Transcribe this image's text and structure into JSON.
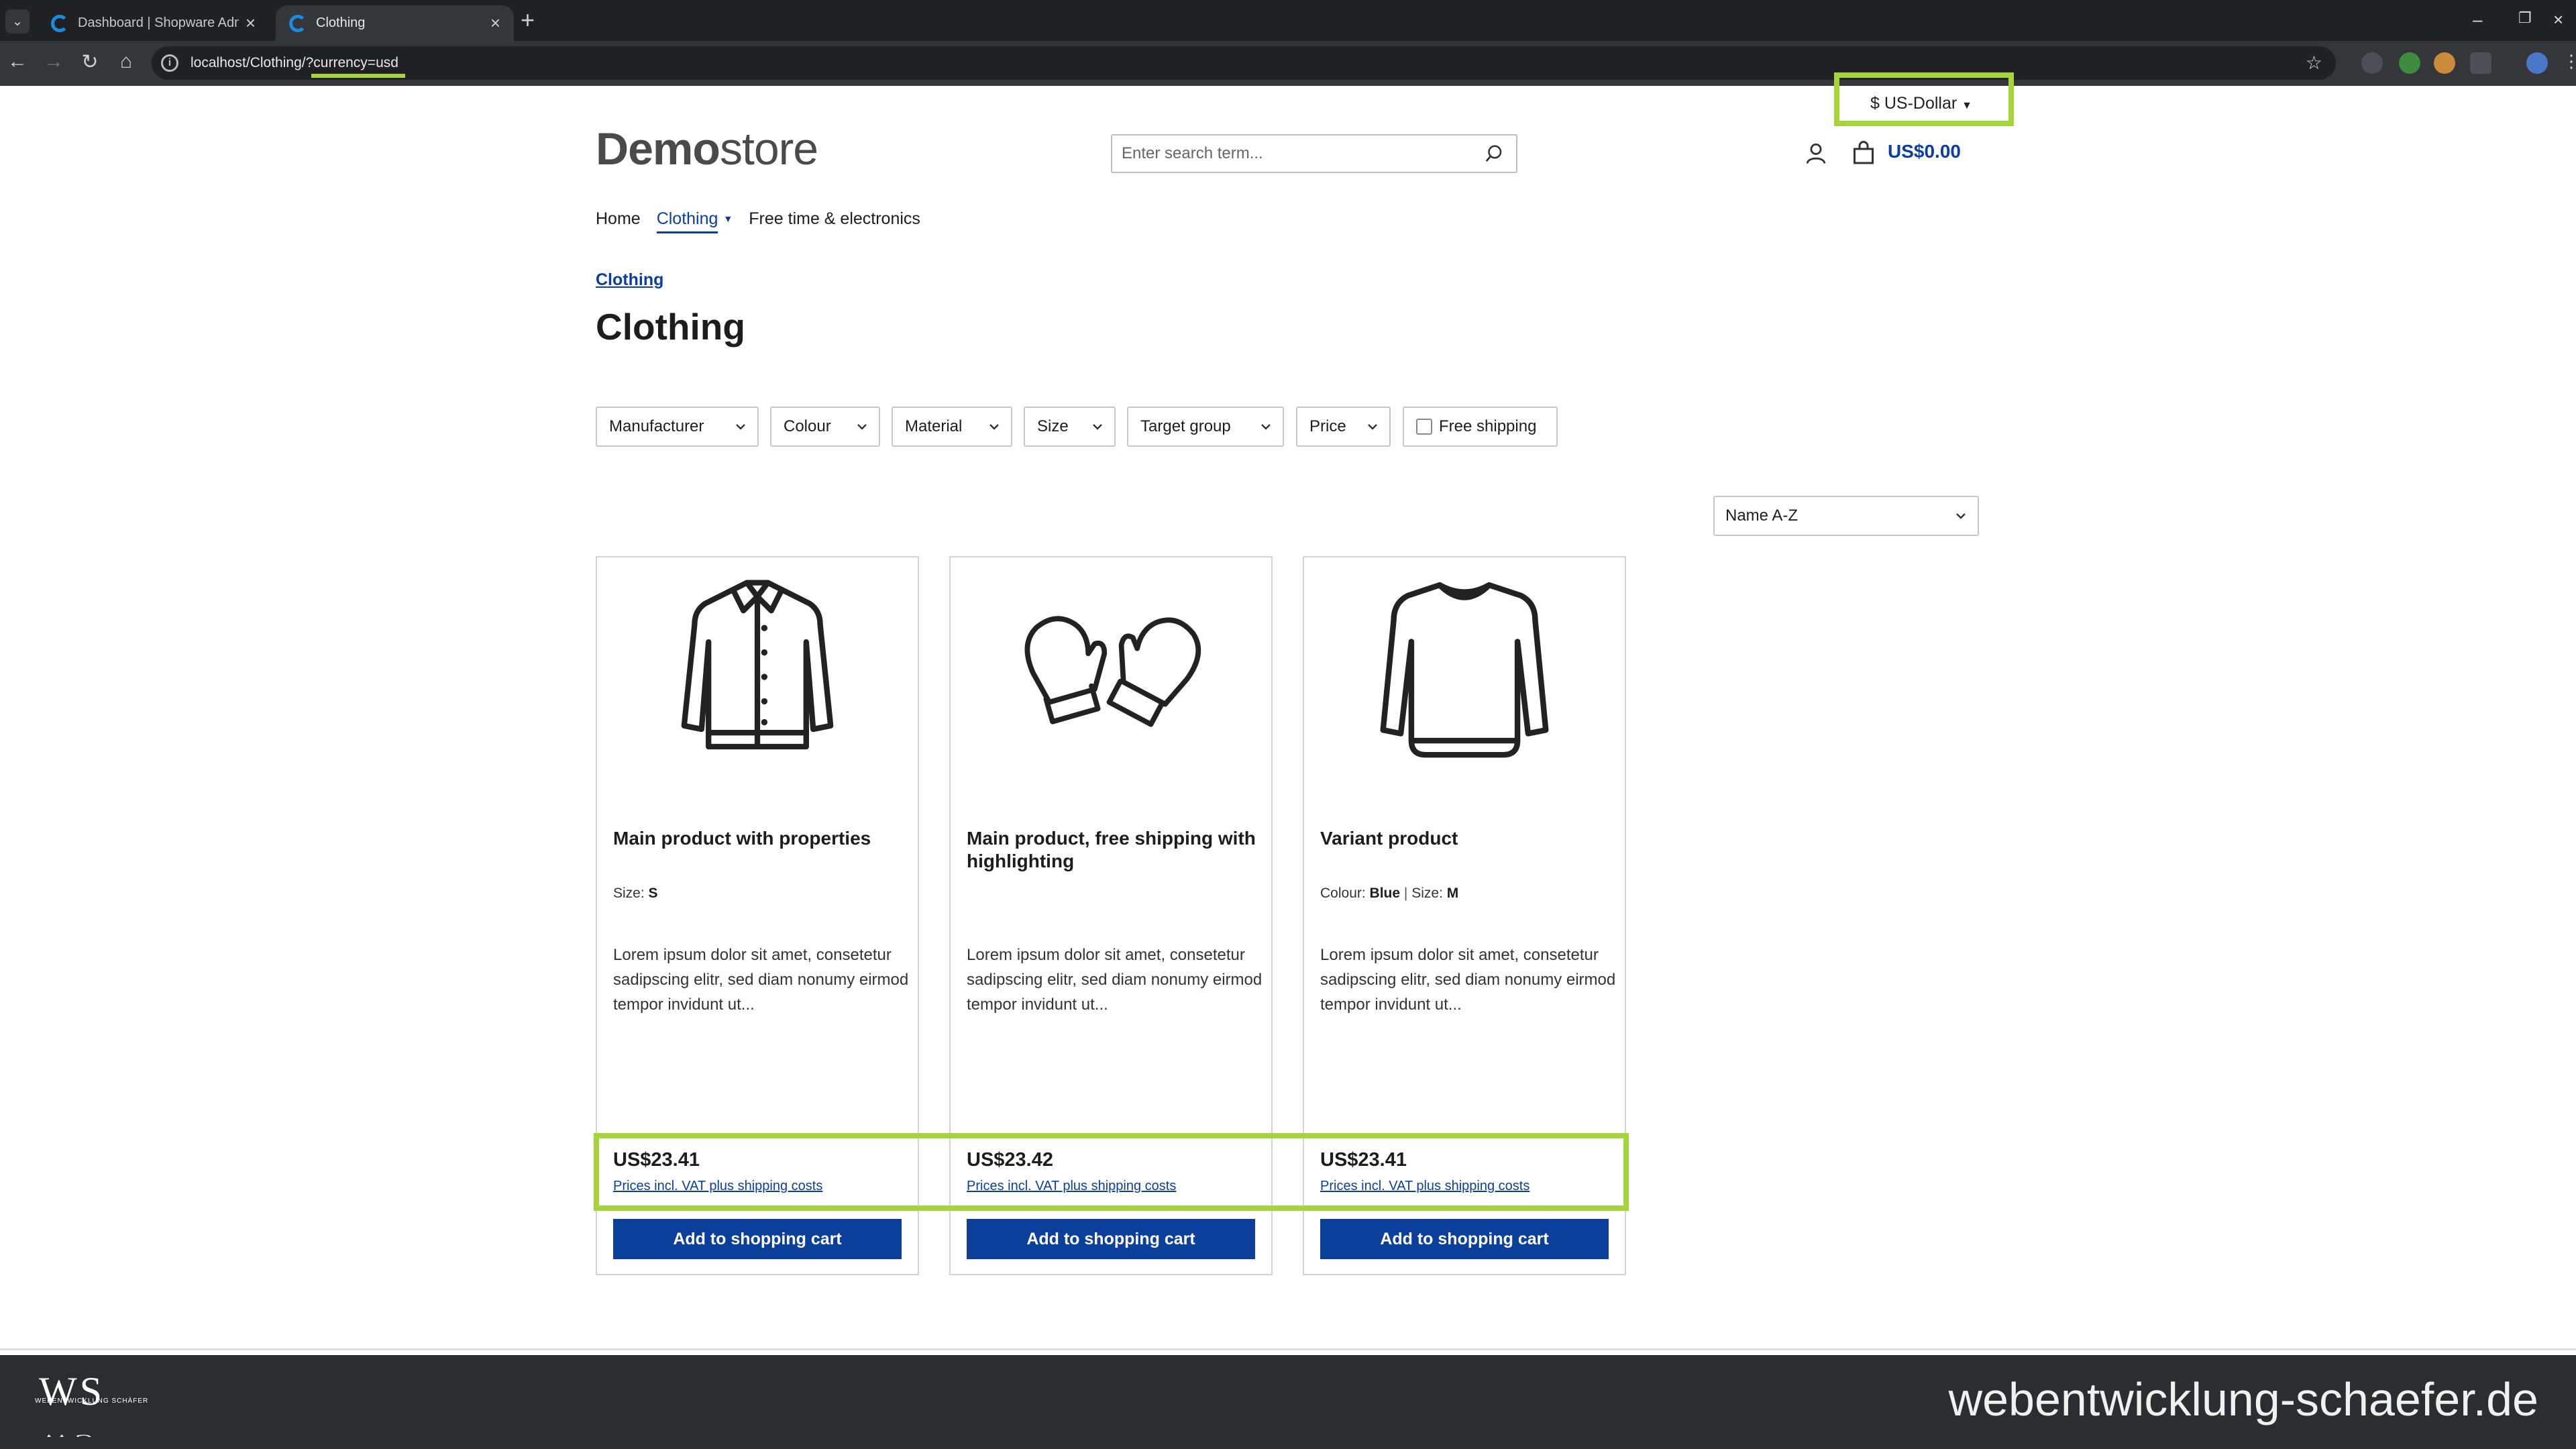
{
  "browser": {
    "tabs": [
      {
        "label": "Dashboard | Shopware Adminis",
        "active": false
      },
      {
        "label": "Clothing",
        "active": true
      }
    ],
    "url": "localhost/Clothing/?currency=usd"
  },
  "header": {
    "logo_bold": "Demo",
    "logo_light": "store",
    "search_placeholder": "Enter search term...",
    "currency": "$ US-Dollar",
    "cart_total": "US$0.00"
  },
  "nav": {
    "items": [
      "Home",
      "Clothing",
      "Free time & electronics"
    ]
  },
  "breadcrumb": "Clothing",
  "page_title": "Clothing",
  "filters": {
    "manufacturer": "Manufacturer",
    "colour": "Colour",
    "material": "Material",
    "size": "Size",
    "target_group": "Target group",
    "price": "Price",
    "free_shipping": "Free shipping"
  },
  "sort": {
    "selected": "Name A-Z"
  },
  "products": [
    {
      "name": "Main product with properties",
      "props": [
        {
          "label": "Size:",
          "value": "S"
        }
      ],
      "description": "Lorem ipsum dolor sit amet, consetetur sadipscing elitr, sed diam nonumy eirmod tempor invidunt ut...",
      "price": "US$23.41",
      "vat_note": "Prices incl. VAT plus shipping costs",
      "button": "Add to shopping cart",
      "icon": "jacket-icon"
    },
    {
      "name": "Main product, free shipping with highlighting",
      "props": [],
      "description": "Lorem ipsum dolor sit amet, consetetur sadipscing elitr, sed diam nonumy eirmod tempor invidunt ut...",
      "price": "US$23.42",
      "vat_note": "Prices incl. VAT plus shipping costs",
      "button": "Add to shopping cart",
      "icon": "mittens-icon"
    },
    {
      "name": "Variant product",
      "props": [
        {
          "label": "Colour:",
          "value": "Blue"
        },
        {
          "label": "Size:",
          "value": "M"
        }
      ],
      "description": "Lorem ipsum dolor sit amet, consetetur sadipscing elitr, sed diam nonumy eirmod tempor invidunt ut...",
      "price": "US$23.41",
      "vat_note": "Prices incl. VAT plus shipping costs",
      "button": "Add to shopping cart",
      "icon": "sweater-icon"
    }
  ],
  "footer": {
    "logo_text": "WS",
    "logo_caption": "WEBENTWICKLUNG SCHÄFER",
    "domain": "webentwicklung-schaefer.de"
  },
  "colors": {
    "accent": "#0b3f9c",
    "highlight": "#a6d43b",
    "footer_bg": "#2b2d30"
  }
}
